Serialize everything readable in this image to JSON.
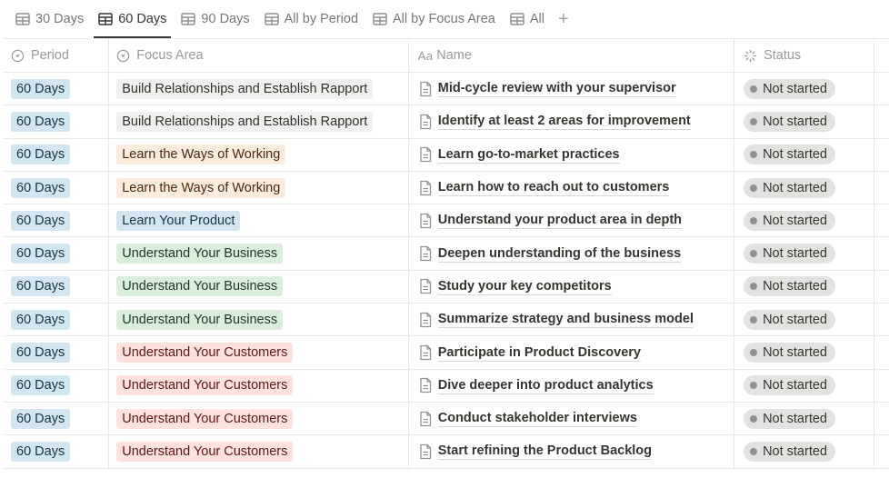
{
  "tabs": [
    {
      "label": "30 Days",
      "icon": "table-icon",
      "active": false
    },
    {
      "label": "60 Days",
      "icon": "table-icon",
      "active": true
    },
    {
      "label": "90 Days",
      "icon": "table-icon",
      "active": false
    },
    {
      "label": "All by Period",
      "icon": "table-icon",
      "active": false
    },
    {
      "label": "All by Focus Area",
      "icon": "table-icon",
      "active": false
    },
    {
      "label": "All",
      "icon": "table-icon",
      "active": false
    }
  ],
  "add_view_label": "+",
  "columns": {
    "period": {
      "label": "Period",
      "icon": "select-icon"
    },
    "focus": {
      "label": "Focus Area",
      "icon": "select-icon"
    },
    "name": {
      "label": "Name",
      "icon_text": "Aa"
    },
    "status": {
      "label": "Status",
      "icon": "status-icon"
    }
  },
  "colors": {
    "period_bg": "#d3e5ef",
    "period_fg": "#183347",
    "focus_styles": {
      "Build Relationships and Establish Rapport": {
        "bg": "#f1f0ef",
        "fg": "#32302c"
      },
      "Learn the Ways of Working": {
        "bg": "#fbecdd",
        "fg": "#49290e"
      },
      "Learn Your Product": {
        "bg": "#d3e5ef",
        "fg": "#183347"
      },
      "Understand Your Business": {
        "bg": "#dbeddb",
        "fg": "#1c3829"
      },
      "Understand Your Customers": {
        "bg": "#ffe2dd",
        "fg": "#5d1715"
      }
    }
  },
  "rows": [
    {
      "period": "60 Days",
      "focus": "Build Relationships and Establish Rapport",
      "name": "Mid-cycle review with your supervisor",
      "status": "Not started"
    },
    {
      "period": "60 Days",
      "focus": "Build Relationships and Establish Rapport",
      "name": "Identify at least 2 areas for improvement",
      "status": "Not started"
    },
    {
      "period": "60 Days",
      "focus": "Learn the Ways of Working",
      "name": "Learn go-to-market practices",
      "status": "Not started"
    },
    {
      "period": "60 Days",
      "focus": "Learn the Ways of Working",
      "name": "Learn how to reach out to customers",
      "status": "Not started"
    },
    {
      "period": "60 Days",
      "focus": "Learn Your Product",
      "name": "Understand your product area in depth",
      "status": "Not started"
    },
    {
      "period": "60 Days",
      "focus": "Understand Your Business",
      "name": "Deepen understanding of the business",
      "status": "Not started"
    },
    {
      "period": "60 Days",
      "focus": "Understand Your Business",
      "name": "Study your key competitors",
      "status": "Not started"
    },
    {
      "period": "60 Days",
      "focus": "Understand Your Business",
      "name": "Summarize strategy and business model",
      "status": "Not started"
    },
    {
      "period": "60 Days",
      "focus": "Understand Your Customers",
      "name": "Participate in Product Discovery",
      "status": "Not started"
    },
    {
      "period": "60 Days",
      "focus": "Understand Your Customers",
      "name": "Dive deeper into product analytics",
      "status": "Not started"
    },
    {
      "period": "60 Days",
      "focus": "Understand Your Customers",
      "name": "Conduct stakeholder interviews",
      "status": "Not started"
    },
    {
      "period": "60 Days",
      "focus": "Understand Your Customers",
      "name": "Start refining the Product Backlog",
      "status": "Not started"
    }
  ]
}
